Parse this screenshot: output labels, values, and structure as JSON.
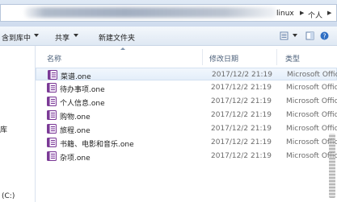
{
  "address": {
    "crumbs": [
      "linux",
      "个人"
    ]
  },
  "toolbar": {
    "include_library": "含到库中",
    "share": "共享",
    "new_folder": "新建文件夹"
  },
  "nav": {
    "library_fragment": "库",
    "drive_fragment": "(C:)"
  },
  "columns": {
    "name": "名称",
    "modified": "修改日期",
    "type": "类型"
  },
  "files": [
    {
      "name": "菜谱.one",
      "modified": "2017/12/2 21:19",
      "type": "Microsoft Office"
    },
    {
      "name": "待办事项.one",
      "modified": "2017/12/2 21:19",
      "type": "Microsoft Office"
    },
    {
      "name": "个人信息.one",
      "modified": "2017/12/2 21:19",
      "type": "Microsoft Office"
    },
    {
      "name": "购物.one",
      "modified": "2017/12/2 21:19",
      "type": "Microsoft Office"
    },
    {
      "name": "旅程.one",
      "modified": "2017/12/2 21:19",
      "type": "Microsoft Office"
    },
    {
      "name": "书籍、电影和音乐.one",
      "modified": "2017/12/2 21:19",
      "type": "Microsoft Office"
    },
    {
      "name": "杂项.one",
      "modified": "2017/12/2 21:19",
      "type": "Microsoft Office"
    }
  ],
  "colors": {
    "toolbar_top": "#f4f8fc",
    "toolbar_bottom": "#dfe8f3",
    "header_text": "#4c607a",
    "onenote_purple": "#7b3a96",
    "selection": "#e4eefa"
  },
  "icons": {
    "file": "onenote-section-icon",
    "refresh": "view-options-icon",
    "help": "help-icon"
  }
}
